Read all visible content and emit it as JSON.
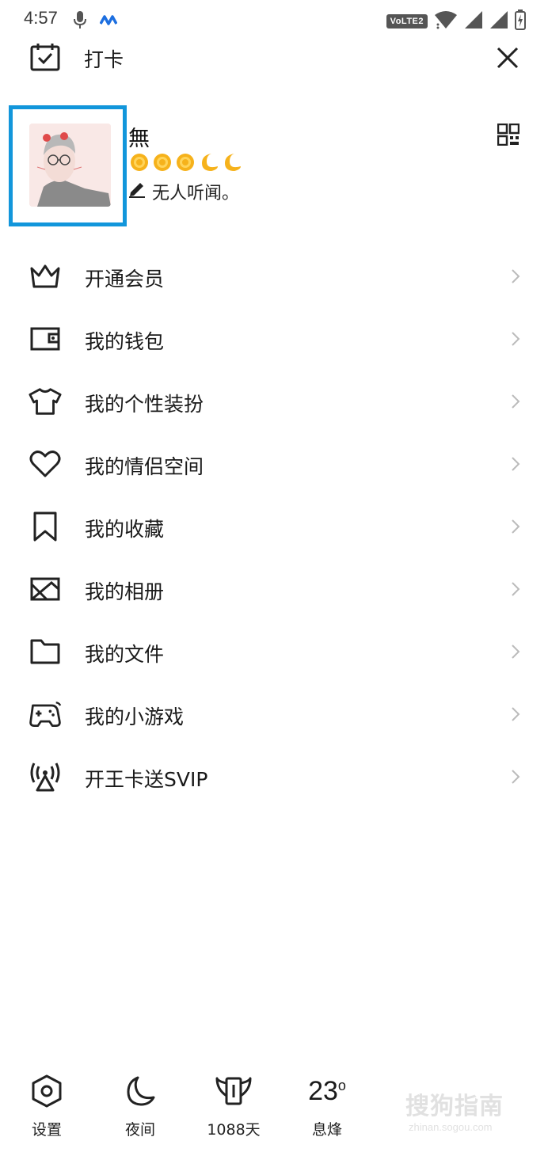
{
  "status_bar": {
    "time": "4:57",
    "network_badge": "VoLTE2",
    "icons": [
      "mic-icon",
      "app-notification-icon",
      "wifi-icon",
      "signal-icon",
      "signal-icon",
      "battery-icon"
    ]
  },
  "top_bar": {
    "checkin_label": "打卡",
    "checkin_icon": "calendar-check-icon",
    "close_icon": "close-icon"
  },
  "profile": {
    "username": "無",
    "level_icons": [
      "sun",
      "sun",
      "sun",
      "moon",
      "moon"
    ],
    "signature": "无人听闻。",
    "qr_icon": "qr-code-icon",
    "highlight_color": "#1296db"
  },
  "menu": {
    "items": [
      {
        "label": "开通会员",
        "icon": "crown-icon"
      },
      {
        "label": "我的钱包",
        "icon": "wallet-icon"
      },
      {
        "label": "我的个性装扮",
        "icon": "tshirt-icon"
      },
      {
        "label": "我的情侣空间",
        "icon": "heart-icon"
      },
      {
        "label": "我的收藏",
        "icon": "bookmark-icon"
      },
      {
        "label": "我的相册",
        "icon": "photo-album-icon"
      },
      {
        "label": "我的文件",
        "icon": "folder-icon"
      },
      {
        "label": "我的小游戏",
        "icon": "gamepad-icon"
      },
      {
        "label": "开王卡送SVIP",
        "icon": "broadcast-icon"
      }
    ]
  },
  "bottom_bar": {
    "settings_label": "设置",
    "night_label": "夜间",
    "days_label": "1088天",
    "temperature": "23",
    "temperature_unit": "o",
    "city_label": "息烽"
  },
  "watermark": {
    "text": "搜狗指南",
    "sub": "zhinan.sogou.com"
  }
}
